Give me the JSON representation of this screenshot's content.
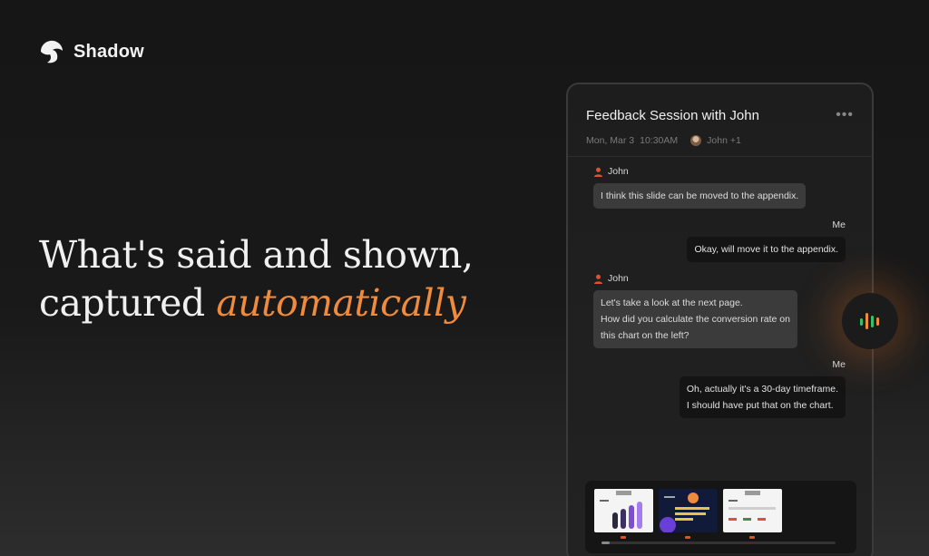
{
  "brand": {
    "name": "Shadow"
  },
  "headline": {
    "line1": "What's said and shown,",
    "line2_pre": "captured ",
    "line2_accent": "automatically"
  },
  "session": {
    "title": "Feedback Session with John",
    "date": "Mon, Mar 3",
    "time": "10:30AM",
    "participants": "John +1"
  },
  "messages": [
    {
      "sender": "John",
      "text": "I think this slide can be moved to the appendix."
    },
    {
      "sender": "Me",
      "text": "Okay, will move it to the appendix."
    },
    {
      "sender": "John",
      "lines": [
        "Let's take a look at the next page.",
        "How did you calculate the conversion rate on",
        "this chart on the left?"
      ]
    },
    {
      "sender": "Me",
      "lines": [
        "Oh, actually it's a 30-day timeframe.",
        "I should have put that on the chart."
      ]
    }
  ],
  "colors": {
    "accent": "#f08a3c",
    "sender_icon": "#e0522c"
  }
}
